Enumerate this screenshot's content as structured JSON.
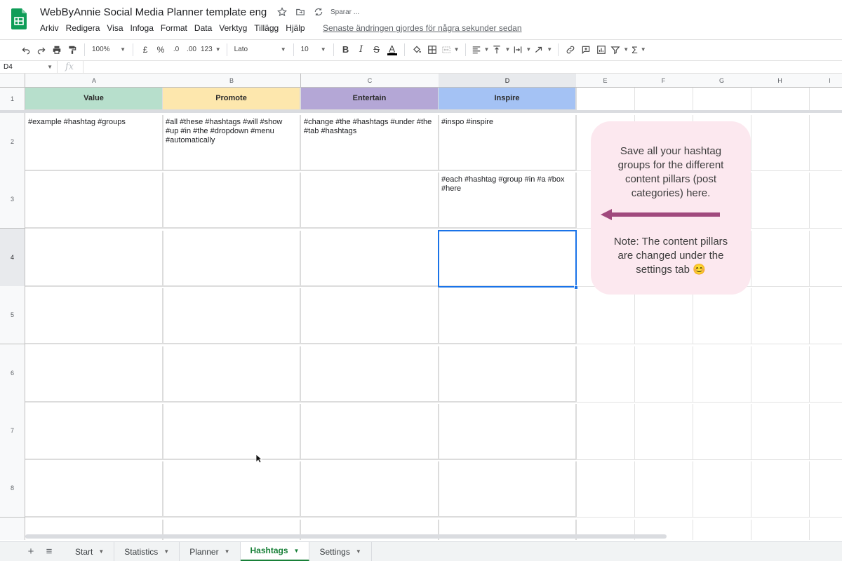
{
  "window": {
    "doc_title": "WebByAnnie Social Media Planner template eng",
    "saving_status": "Sparar ...",
    "last_edit": "Senaste ändringen gjordes för några sekunder sedan"
  },
  "menu": [
    "Arkiv",
    "Redigera",
    "Visa",
    "Infoga",
    "Format",
    "Data",
    "Verktyg",
    "Tillägg",
    "Hjälp"
  ],
  "toolbar": {
    "zoom": "100%",
    "currency": "£",
    "percent": "%",
    "decrease_decimals": ".0",
    "increase_decimals": ".00",
    "more_formats": "123",
    "font": "Lato",
    "font_size": "10",
    "bold": "B",
    "italic": "I",
    "strikethrough": "S",
    "text_color": "A",
    "functions": "Σ"
  },
  "formula_bar": {
    "cell_ref": "D4",
    "fx": "fx",
    "value": ""
  },
  "columns": [
    "A",
    "B",
    "C",
    "D",
    "E",
    "F",
    "G",
    "H",
    "I"
  ],
  "rows": [
    "1",
    "2",
    "3",
    "4",
    "5",
    "6",
    "7",
    "8"
  ],
  "header_cells": {
    "A": "Value",
    "B": "Promote",
    "C": "Entertain",
    "D": "Inspire"
  },
  "header_colors": {
    "A": "#b7dfcc",
    "B": "#fde7ad",
    "C": "#b4a7d6",
    "D": "#a4c2f4"
  },
  "cells": {
    "A2": "#example #hashtag #groups",
    "B2": "#all #these #hashtags #will #show #up #in #the #dropdown #menu #automatically",
    "C2": "#change #the #hashtags #under #the #tab #hashtags",
    "D2": "#inspo #inspire",
    "D3": "#each #hashtag #group #in #a #box #here"
  },
  "note": {
    "text1": "Save all your hashtag groups for the different content pillars (post categories) here.",
    "text2": "Note: The content pillars are changed under the settings tab 😊",
    "arrow_color": "#a0497d"
  },
  "sheet_tabs": {
    "add": "+",
    "all_sheets": "≡",
    "tabs": [
      "Start",
      "Statistics",
      "Planner",
      "Hashtags",
      "Settings"
    ],
    "active": "Hashtags"
  }
}
